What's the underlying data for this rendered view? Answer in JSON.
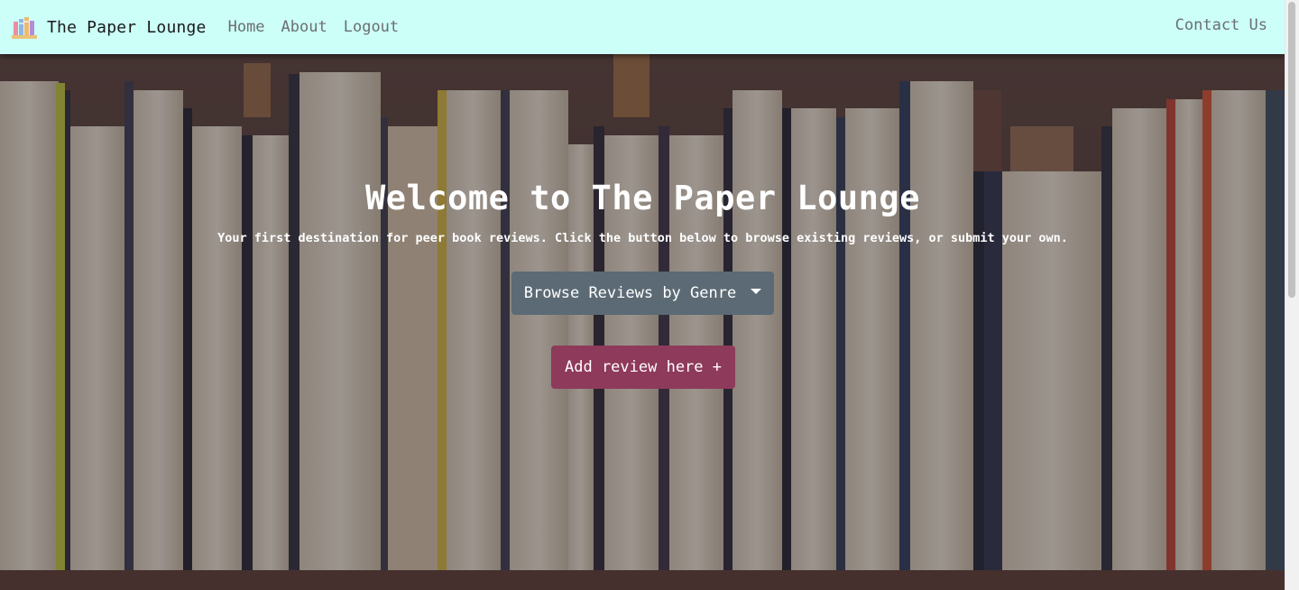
{
  "navbar": {
    "brand": "The Paper Lounge",
    "brand_icon": "books-icon",
    "links": [
      "Home",
      "About",
      "Logout"
    ],
    "contact": "Contact Us",
    "background": "#ccfff8"
  },
  "hero": {
    "title": "Welcome to The Paper Lounge",
    "subtitle": "Your first destination for peer book reviews. Click the button below to browse existing reviews, or submit your own.",
    "browse_button": "Browse Reviews by Genre",
    "add_button": "Add review here +",
    "browse_color": "#5b6a74",
    "add_color": "#8e3a5a"
  }
}
